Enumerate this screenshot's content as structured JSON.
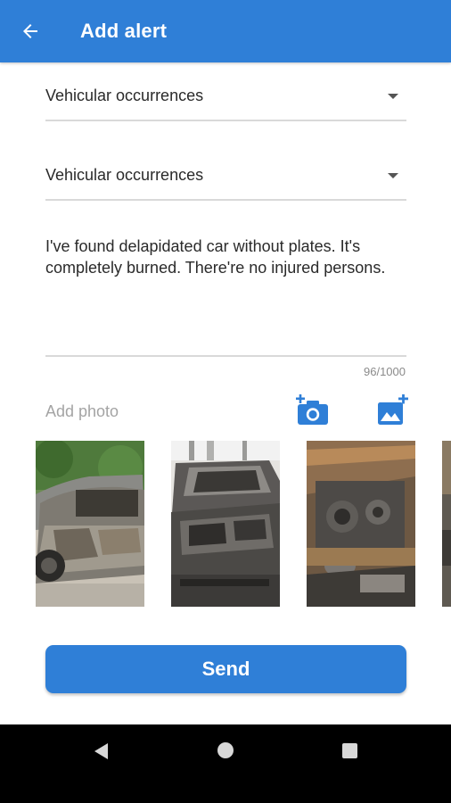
{
  "app_bar": {
    "title": "Add alert",
    "color": "#2f7fd7",
    "back_icon": "arrow-back-icon"
  },
  "form": {
    "category_dropdown": {
      "value": "Vehicular occurrences"
    },
    "subcategory_dropdown": {
      "value": "Vehicular occurrences"
    },
    "description": {
      "value": "I've found delapidated car without plates. It's completely burned. There're no injured persons.",
      "counter": "96/1000"
    },
    "photos": {
      "label": "Add photo",
      "camera_icon": "add-camera-icon",
      "gallery_icon": "add-image-icon",
      "items": [
        {
          "description": "burned car side view"
        },
        {
          "description": "burned car front"
        },
        {
          "description": "burned engine bay"
        },
        {
          "description": "partial photo"
        }
      ]
    },
    "send_label": "Send"
  },
  "nav_bar": {
    "back_icon": "nav-back-icon",
    "home_icon": "nav-home-icon",
    "recent_icon": "nav-recent-icon"
  }
}
